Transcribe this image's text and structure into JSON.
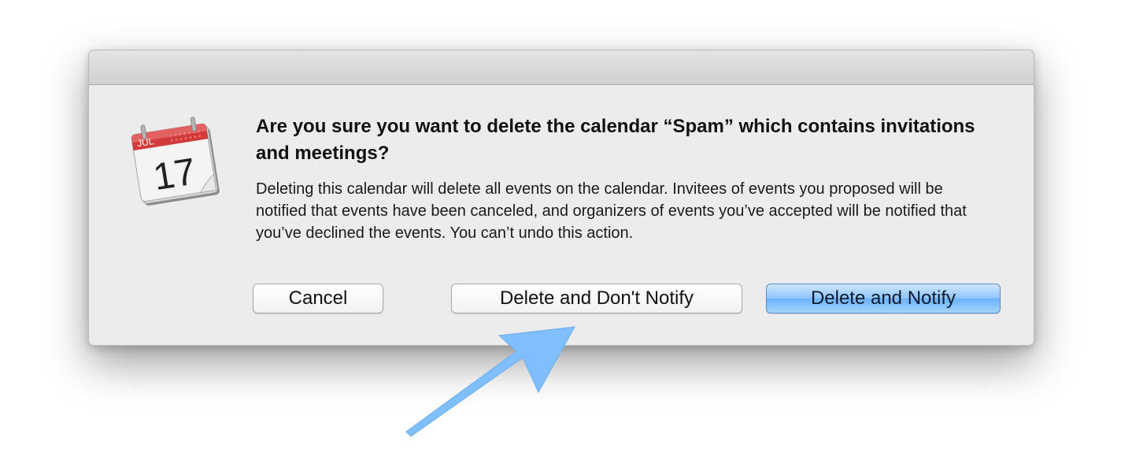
{
  "dialog": {
    "headline": "Are you sure you want to delete the calendar “Spam” which contains invitations and meetings?",
    "message": "Deleting this calendar will delete all events on the calendar. Invitees of events you proposed will be notified that events have been canceled, and organizers of events you’ve accepted will be notified that you’ve declined the events. You can’t undo this action.",
    "icon": {
      "name": "calendar-app-icon",
      "month": "JUL",
      "day": "17"
    },
    "buttons": {
      "cancel": "Cancel",
      "delete_dont_notify": "Delete and Don't Notify",
      "delete_notify": "Delete and Notify"
    }
  },
  "annotation": {
    "icon": "pointer-arrow",
    "color": "#7fbfff"
  },
  "colors": {
    "default_button_blue": "#8fc6ff",
    "calendar_red": "#d33a3a"
  }
}
